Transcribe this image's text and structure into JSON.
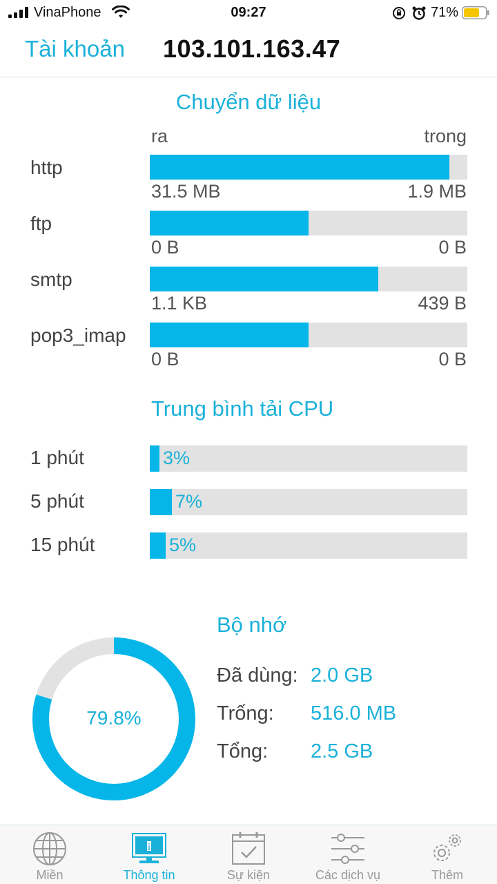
{
  "status_bar": {
    "carrier": "VinaPhone",
    "time": "09:27",
    "battery": "71%"
  },
  "header": {
    "back_label": "Tài khoản",
    "title": "103.101.163.47"
  },
  "transfer": {
    "title": "Chuyển dữ liệu",
    "out_label": "ra",
    "in_label": "trong",
    "rows": [
      {
        "name": "http",
        "out": "31.5 MB",
        "in": "1.9 MB",
        "out_share": 0.943
      },
      {
        "name": "ftp",
        "out": "0 B",
        "in": "0 B",
        "out_share": 0.5
      },
      {
        "name": "smtp",
        "out": "1.1 KB",
        "in": "439 B",
        "out_share": 0.72
      },
      {
        "name": "pop3_imap",
        "out": "0 B",
        "in": "0 B",
        "out_share": 0.5
      }
    ]
  },
  "cpu": {
    "title": "Trung bình tải CPU",
    "rows": [
      {
        "label": "1 phút",
        "value": "3%",
        "percent": 3
      },
      {
        "label": "5 phút",
        "value": "7%",
        "percent": 7
      },
      {
        "label": "15 phút",
        "value": "5%",
        "percent": 5
      }
    ]
  },
  "memory": {
    "title": "Bộ nhớ",
    "percent_label": "79.8%",
    "percent": 79.8,
    "used_label": "Đã dùng:",
    "used": "2.0 GB",
    "free_label": "Trống:",
    "free": "516.0 MB",
    "total_label": "Tổng:",
    "total": "2.5 GB"
  },
  "tabs": [
    {
      "label": "Miền",
      "icon": "globe-icon",
      "active": false
    },
    {
      "label": "Thông tin",
      "icon": "monitor-icon",
      "active": true
    },
    {
      "label": "Sự kiện",
      "icon": "calendar-icon",
      "active": false
    },
    {
      "label": "Các dịch vụ",
      "icon": "sliders-icon",
      "active": false
    },
    {
      "label": "Thêm",
      "icon": "gears-icon",
      "active": false
    }
  ],
  "colors": {
    "accent": "#1ab1d9",
    "bar_fill": "#06b6e8",
    "bar_track": "#e2e2e2"
  }
}
